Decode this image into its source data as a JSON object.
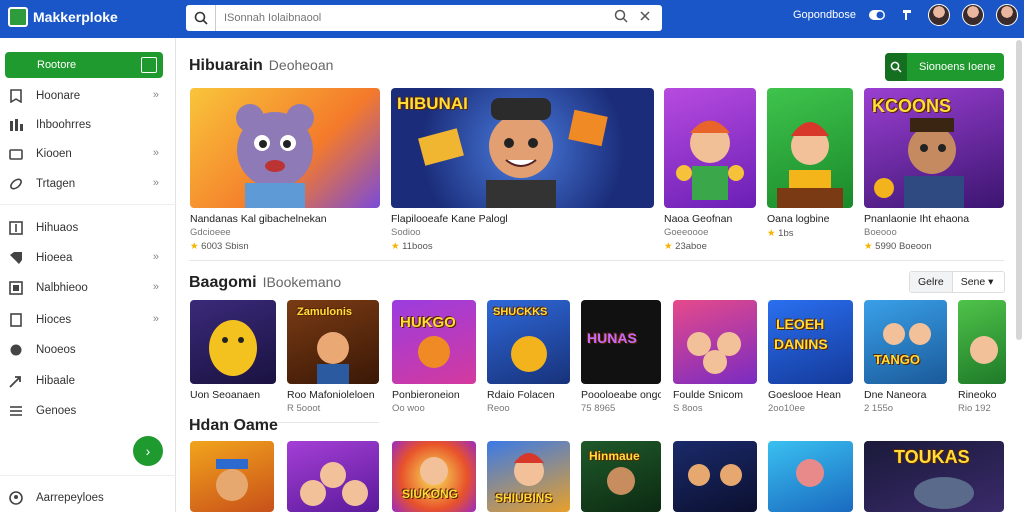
{
  "topbar": {
    "logo_text": "Makkerploke",
    "search_placeholder": "ISonnah Iolaibnaool",
    "link": "Gopondbose",
    "brand_color": "#1a56c8"
  },
  "sidebar": {
    "primary_label": "Rootore",
    "items": [
      {
        "label": "Hoonare",
        "icon": "bookmark-icon"
      },
      {
        "label": "Ihboohrres",
        "icon": "bar-chart-icon"
      },
      {
        "label": "Kiooen",
        "icon": "folder-icon"
      },
      {
        "label": "Trtagen",
        "icon": "link-icon"
      },
      {
        "label": "Hihuaos",
        "icon": "number-icon"
      },
      {
        "label": "Hioeea",
        "icon": "tag-icon"
      },
      {
        "label": "Nalbhieoo",
        "icon": "grid-icon"
      },
      {
        "label": "Hioces",
        "icon": "square-icon"
      },
      {
        "label": "Nooeos",
        "icon": "circle-icon"
      },
      {
        "label": "Hibaale",
        "icon": "arrow-icon"
      },
      {
        "label": "Genoes",
        "icon": "sliders-icon"
      }
    ],
    "footer_label": "Aarrepeyloes",
    "accent_color": "#1f9a2e"
  },
  "hero": {
    "title": "Hibuarain",
    "subtitle": "Deoheoan",
    "button_label": "Sionoens Ioene",
    "cards": [
      {
        "name": "Nandanas Kal gibachelnekan",
        "meta": "Gdcioeee",
        "rating": "6003 Sbisn"
      },
      {
        "name": "Flapilooeafe Kane Palogl",
        "meta": "Sodioo",
        "rating": "11boos"
      },
      {
        "name": "Naoa Geofnan",
        "meta": "Goeeoooe",
        "rating": "23aboe"
      },
      {
        "name": "Oana logbine",
        "meta": "",
        "rating": "1bs"
      },
      {
        "name": "Pnanlaonie Iht ehaona",
        "meta": "Boeooo",
        "rating": "5990 Boeoon"
      }
    ]
  },
  "section2": {
    "title": "Baagomi",
    "subtitle": "IBookemano",
    "sort_left": "Gelre",
    "sort_right": "Sene",
    "cards": [
      {
        "name": "Uon Seoanaen",
        "meta": ""
      },
      {
        "name": "Roo Mafonioleloen",
        "meta": "R 5ooot"
      },
      {
        "name": "Ponbieroneion",
        "meta": "Oo woo"
      },
      {
        "name": "Rdaio Folacen",
        "meta": "Reoo"
      },
      {
        "name": "Poooloeabe ongon",
        "meta": "75 8965"
      },
      {
        "name": "Foulde Snicom",
        "meta": "S 8oos"
      },
      {
        "name": "Goeslooe Hean",
        "meta": "2oo10ee"
      },
      {
        "name": "Dne Naneora",
        "meta": "2 155o"
      },
      {
        "name": "Rineoko",
        "meta": "Rio 192"
      }
    ]
  },
  "section3": {
    "title": "Hdan Oame"
  }
}
